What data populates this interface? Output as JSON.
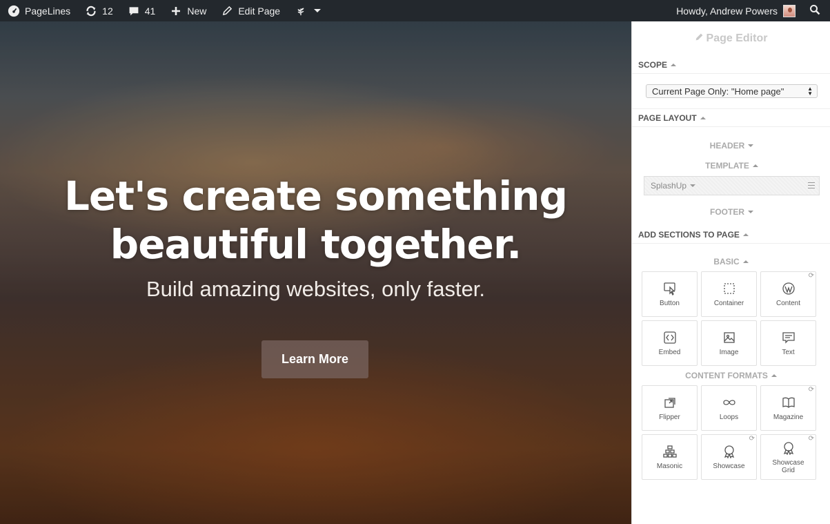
{
  "adminbar": {
    "site": "PageLines",
    "updates": "12",
    "comments": "41",
    "new_label": "New",
    "edit_label": "Edit Page",
    "greeting": "Howdy, Andrew Powers"
  },
  "hero": {
    "title_line1": "Let's create something",
    "title_line2": "beautiful together.",
    "subtitle": "Build amazing websites, only faster.",
    "button": "Learn More"
  },
  "panel": {
    "title": "Page Editor",
    "scope_heading": "SCOPE",
    "scope_value": "Current Page Only: \"Home page\"",
    "layout_heading": "PAGE LAYOUT",
    "header_label": "HEADER",
    "template_label": "TEMPLATE",
    "template_value": "SplashUp",
    "footer_label": "FOOTER",
    "add_heading": "ADD SECTIONS TO PAGE",
    "categories": [
      {
        "name": "BASIC",
        "items": [
          {
            "label": "Button",
            "icon": "cursor-icon",
            "refresh": false
          },
          {
            "label": "Container",
            "icon": "dashed-box-icon",
            "refresh": false
          },
          {
            "label": "Content",
            "icon": "wordpress-icon",
            "refresh": true
          },
          {
            "label": "Embed",
            "icon": "code-icon",
            "refresh": false
          },
          {
            "label": "Image",
            "icon": "image-icon",
            "refresh": false
          },
          {
            "label": "Text",
            "icon": "text-bubble-icon",
            "refresh": false
          }
        ]
      },
      {
        "name": "CONTENT FORMATS",
        "items": [
          {
            "label": "Flipper",
            "icon": "flipper-icon",
            "refresh": false
          },
          {
            "label": "Loops",
            "icon": "infinity-icon",
            "refresh": false
          },
          {
            "label": "Magazine",
            "icon": "book-icon",
            "refresh": true
          },
          {
            "label": "Masonic",
            "icon": "masonry-icon",
            "refresh": false
          },
          {
            "label": "Showcase",
            "icon": "award-icon",
            "refresh": true
          },
          {
            "label": "Showcase Grid",
            "icon": "award-icon",
            "refresh": true
          }
        ]
      }
    ]
  }
}
